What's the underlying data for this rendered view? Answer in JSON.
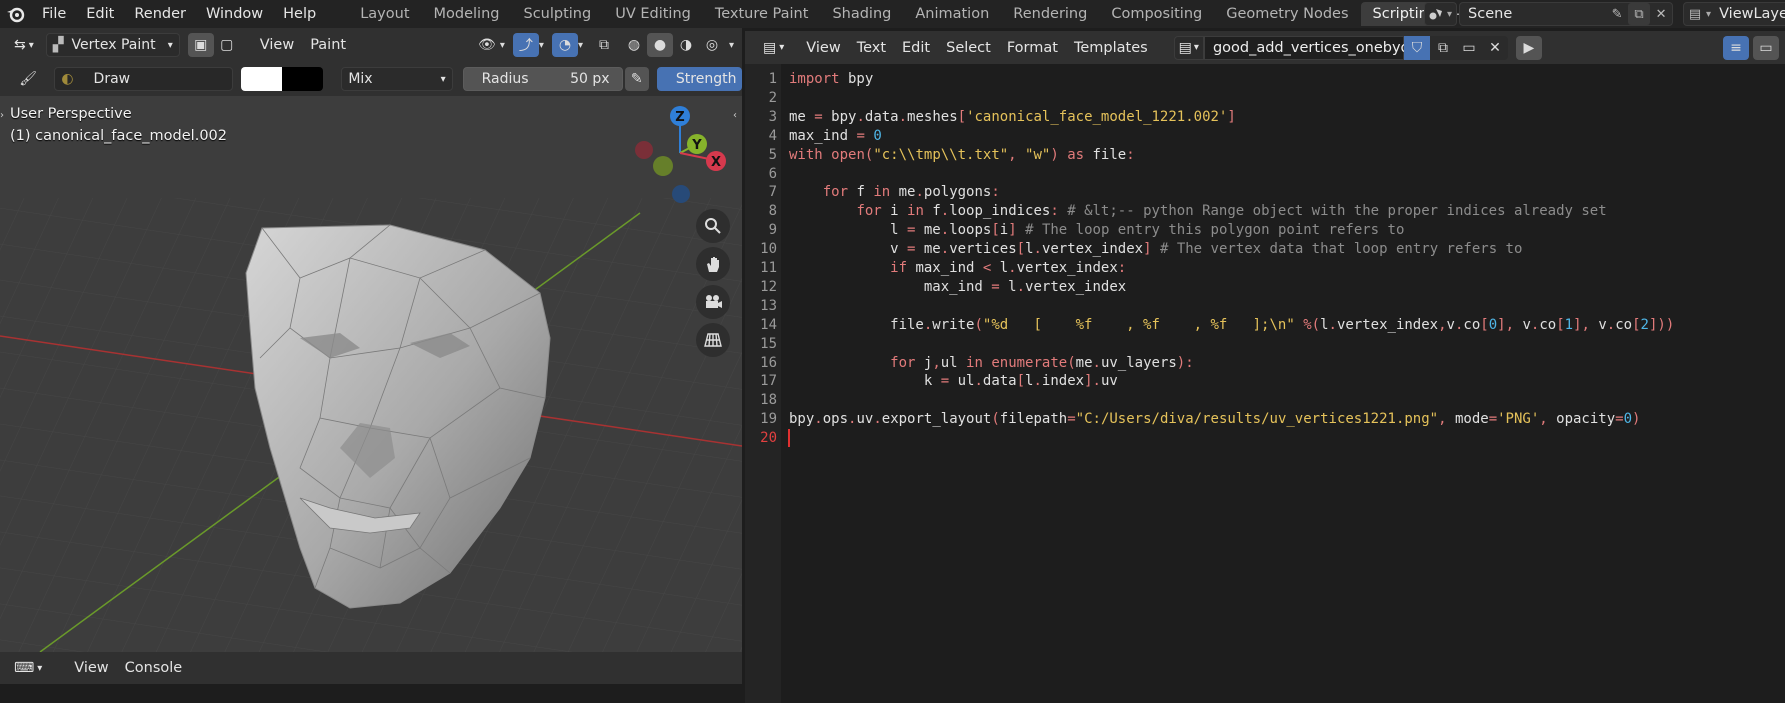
{
  "app_menu": [
    "File",
    "Edit",
    "Render",
    "Window",
    "Help"
  ],
  "workspace_tabs": [
    "Layout",
    "Modeling",
    "Sculpting",
    "UV Editing",
    "Texture Paint",
    "Shading",
    "Animation",
    "Rendering",
    "Compositing",
    "Geometry Nodes",
    "Scripting"
  ],
  "active_workspace": "Scripting",
  "scene": {
    "name": "Scene",
    "view_layer": "ViewLayer"
  },
  "viewport": {
    "mode": "Vertex Paint",
    "menus": [
      "View",
      "Paint"
    ],
    "brush": "Draw",
    "blend": "Mix",
    "radius_label": "Radius",
    "radius_value": "50 px",
    "strength_label": "Strength",
    "overlay_title": "User Perspective",
    "overlay_object": "(1) canonical_face_model.002",
    "gizmo": {
      "x": "X",
      "y": "Y",
      "z": "Z"
    }
  },
  "console": {
    "menus": [
      "View",
      "Console"
    ]
  },
  "text_editor": {
    "menus": [
      "View",
      "Text",
      "Edit",
      "Select",
      "Format",
      "Templates"
    ],
    "filename": "good_add_vertices_onebyone",
    "current_line": 20,
    "lines": [
      "import bpy",
      "",
      "me = bpy.data.meshes['canonical_face_model_1221.002']",
      "max_ind = 0",
      "with open(\"c:\\\\tmp\\\\t.txt\", \"w\") as file:",
      "",
      "    for f in me.polygons:",
      "        for i in f.loop_indices: # &lt;-- python Range object with the proper indices already set",
      "            l = me.loops[i] # The loop entry this polygon point refers to",
      "            v = me.vertices[l.vertex_index] # The vertex data that loop entry refers to",
      "            if max_ind < l.vertex_index:",
      "                max_ind = l.vertex_index",
      "",
      "            file.write(\"%d   [    %f    , %f    , %f   ];\\n\" %(l.vertex_index,v.co[0], v.co[1], v.co[2]))",
      "",
      "            for j,ul in enumerate(me.uv_layers):",
      "                k = ul.data[l.index].uv",
      "",
      "bpy.ops.uv.export_layout(filepath=\"C:/Users/diva/results/uv_vertices1221.png\", mode='PNG', opacity=0)",
      ""
    ]
  },
  "colors": {
    "accent": "#4772b3",
    "keyword": "#e27b7b",
    "string": "#e5c25a",
    "number": "#4fb6e7",
    "comment": "#8c8c8c"
  }
}
